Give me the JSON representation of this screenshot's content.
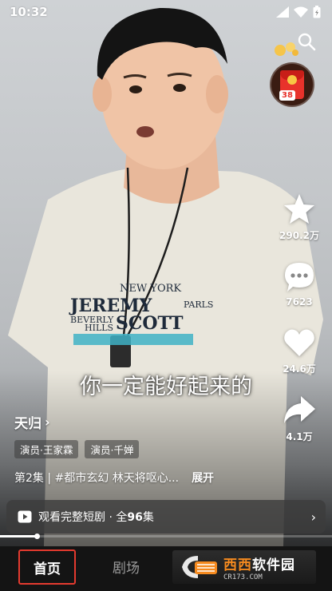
{
  "status_bar": {
    "time": "10:32"
  },
  "redpacket": {
    "badge": "38"
  },
  "side_actions": [
    {
      "name": "favorite",
      "count": "290.2万"
    },
    {
      "name": "comment",
      "count": "7623"
    },
    {
      "name": "like",
      "count": "24.6万"
    },
    {
      "name": "share",
      "count": "4.1万"
    }
  ],
  "video": {
    "subtitle": "你一定能好起来的",
    "shirt_text_1": "NEW YORK",
    "shirt_text_2": "JEREMY",
    "shirt_text_3": "SCOTT",
    "shirt_text_4": "BEVERLY",
    "shirt_text_5": "HILLS",
    "shirt_text_6": "PARLS",
    "progress": 0.11
  },
  "drama": {
    "title": "天归",
    "tags": [
      "演员·王家霖",
      "演员·千婵"
    ],
    "description": "第2集 | #都市玄幻 林天将呕心...",
    "expand_label": "展开"
  },
  "playlist_bar": {
    "text": "观看完整短剧 · 全",
    "count": "96",
    "suffix": "集"
  },
  "tab_bar": {
    "home": "首页",
    "theater": "剧场"
  },
  "watermark": {
    "main_a": "西西",
    "main_b": "软件园",
    "sub": "CR173.COM"
  }
}
